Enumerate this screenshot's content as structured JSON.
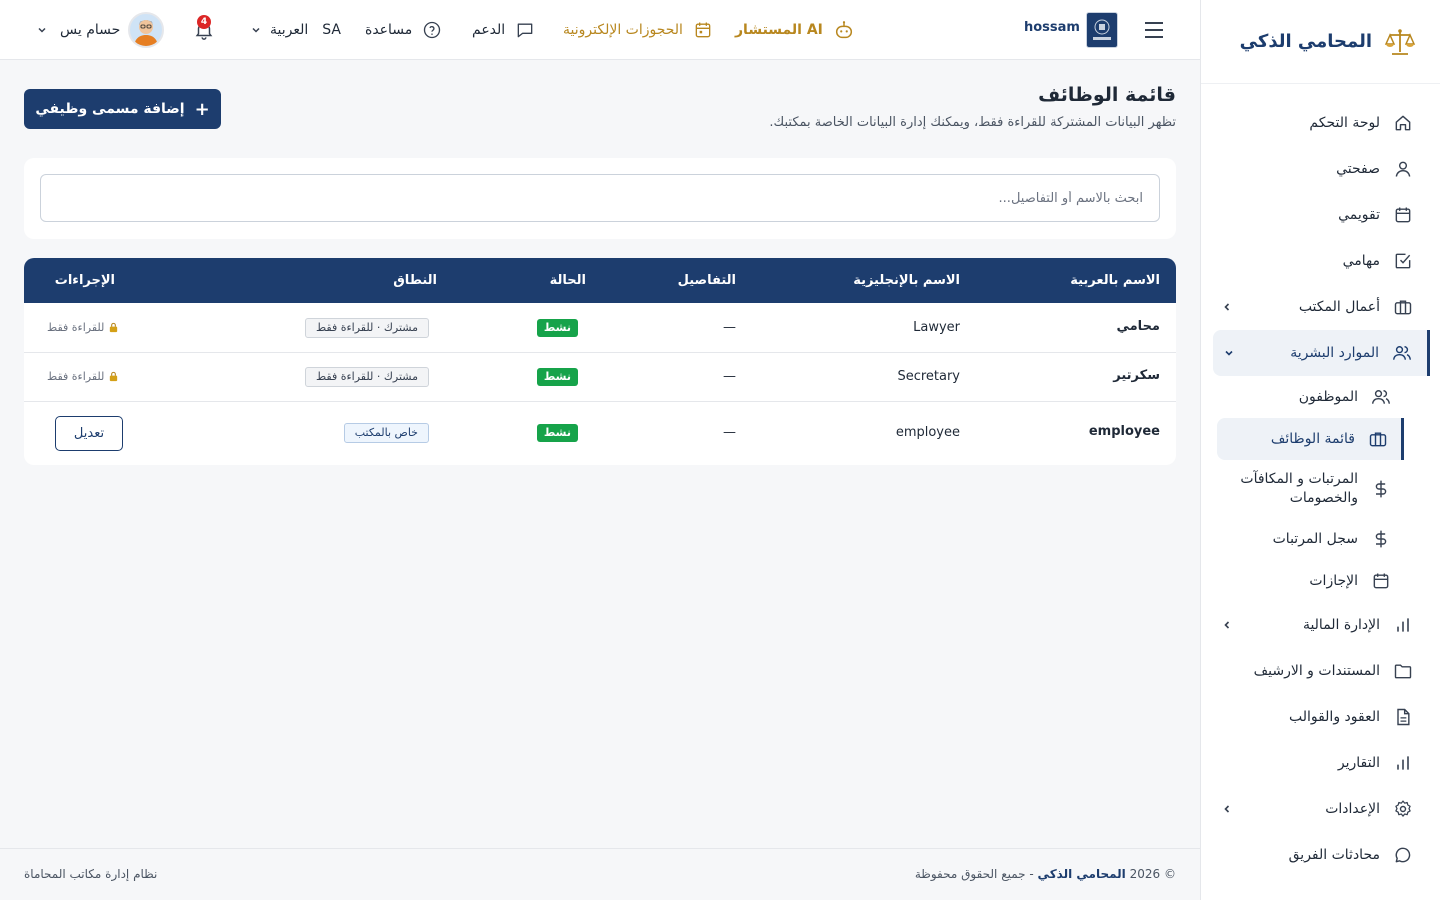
{
  "brand": {
    "name": "المحامي الذكي"
  },
  "sidebar": {
    "items": [
      {
        "label": "لوحة التحكم",
        "icon": "home-icon"
      },
      {
        "label": "صفحتي",
        "icon": "user-icon"
      },
      {
        "label": "تقويمي",
        "icon": "calendar-icon"
      },
      {
        "label": "مهامي",
        "icon": "check-square-icon"
      },
      {
        "label": "أعمال المكتب",
        "icon": "briefcase-icon",
        "expandable": true
      },
      {
        "label": "الموارد البشرية",
        "icon": "users-icon",
        "expanded": true
      },
      {
        "label": "الإدارة المالية",
        "icon": "bar-chart-icon",
        "expandable": true
      },
      {
        "label": "المستندات و الارشيف",
        "icon": "folder-icon"
      },
      {
        "label": "العقود والقوالب",
        "icon": "file-text-icon"
      },
      {
        "label": "التقارير",
        "icon": "bar-chart-icon"
      },
      {
        "label": "الإعدادات",
        "icon": "gear-icon",
        "expandable": true
      },
      {
        "label": "محادثات الفريق",
        "icon": "chat-icon"
      }
    ],
    "hr_sub": [
      {
        "label": "الموظفون",
        "icon": "users-icon"
      },
      {
        "label": "قائمة الوظائف",
        "icon": "briefcase-icon",
        "active": true
      },
      {
        "label": "المرتبات و المكافآت والخصومات",
        "icon": "dollar-icon"
      },
      {
        "label": "سجل المرتبات",
        "icon": "dollar-icon"
      },
      {
        "label": "الإجازات",
        "icon": "calendar-icon"
      }
    ]
  },
  "topbar": {
    "office_name": "hossam",
    "ai_label": "المستشار AI",
    "bookings_label": "الحجوزات الإلكترونية",
    "support_label": "الدعم",
    "help_label": "مساعدة",
    "lang_code": "SA",
    "lang_label": "العربية",
    "notifications_count": "4",
    "user_name": "حسام يس"
  },
  "page": {
    "title": "قائمة الوظائف",
    "subtitle": "تظهر البيانات المشتركة للقراءة فقط، ويمكنك إدارة البيانات الخاصة بمكتبك.",
    "add_button": "إضافة مسمى وظيفي",
    "search_placeholder": "ابحث بالاسم أو التفاصيل..."
  },
  "table": {
    "headers": {
      "name_ar": "الاسم بالعربية",
      "name_en": "الاسم بالإنجليزية",
      "details": "التفاصيل",
      "status": "الحالة",
      "scope": "النطاق",
      "actions": "الإجراءات"
    },
    "rows": [
      {
        "name_ar": "محامي",
        "name_en": "Lawyer",
        "details": "—",
        "status": "نشط",
        "scope": "مشترك · للقراءة فقط",
        "action": "للقراءة فقط"
      },
      {
        "name_ar": "سكرتير",
        "name_en": "Secretary",
        "details": "—",
        "status": "نشط",
        "scope": "مشترك · للقراءة فقط",
        "action": "للقراءة فقط"
      },
      {
        "name_ar": "employee",
        "name_en": "employee",
        "details": "—",
        "status": "نشط",
        "scope": "خاص بالمكتب",
        "action": "تعديل"
      }
    ]
  },
  "footer": {
    "left": "نظام إدارة مكاتب المحاماة",
    "copyright": "© 2026",
    "brand": "المحامي الذكي",
    "rights": "- جميع الحقوق محفوظة"
  },
  "colors": {
    "primary": "#1d3d6e",
    "gold": "#b8871f",
    "success": "#16a34a",
    "danger": "#dc2626"
  }
}
